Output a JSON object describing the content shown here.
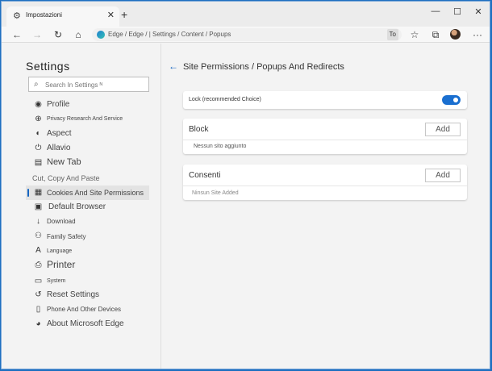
{
  "browser": {
    "tab_title": "Impostazioni",
    "tab_close": "✕",
    "new_tab": "+",
    "window_controls": {
      "minimize": "—",
      "maximize": "☐",
      "close": "✕"
    },
    "address": "Edge / Edge / | Settings / Content / Popups",
    "read_aloud": "To",
    "icons": {
      "back": "←",
      "forward": "→",
      "refresh": "↻",
      "home": "⌂",
      "favorites": "☆",
      "collections": "⧉",
      "more": "···"
    }
  },
  "sidebar": {
    "title": "Settings",
    "search": {
      "placeholder": "Search In Settings ᴺ",
      "icon": "⌕"
    },
    "items": [
      {
        "label": "Profile",
        "icon": "◉"
      },
      {
        "label": "Privacy Research And Service",
        "icon": "⊕"
      },
      {
        "label": "Aspect",
        "icon": "◐"
      },
      {
        "label": "Allavio",
        "icon": "⏻"
      },
      {
        "label": "New Tab",
        "icon": "▤"
      },
      {
        "label": "Cut, Copy And Paste",
        "icon": ""
      },
      {
        "label": "Cookies And Site Permissions",
        "icon": "▦"
      },
      {
        "label": "Default Browser",
        "icon": "▣"
      },
      {
        "label": "Download",
        "icon": "↓"
      },
      {
        "label": "Family Safety",
        "icon": "⚇"
      },
      {
        "label": "Language",
        "icon": "A"
      },
      {
        "label": "Printer",
        "icon": "⎙"
      },
      {
        "label": "System",
        "icon": "▭"
      },
      {
        "label": "Reset Settings",
        "icon": "↺"
      },
      {
        "label": "Phone And Other Devices",
        "icon": "▯"
      },
      {
        "label": "About Microsoft Edge",
        "icon": "◕"
      }
    ]
  },
  "main": {
    "back_icon": "←",
    "title": "Site Permissions / Popups And Redirects",
    "block_toggle": {
      "label": "Lock (recommended Choice)",
      "state": "on",
      "color": "#1a6fd0"
    },
    "block": {
      "title": "Block",
      "add": "Add",
      "empty": "Nessun sito aggiunto"
    },
    "allow": {
      "title": "Consenti",
      "add": "Add",
      "empty": "Ninsun Site Added"
    }
  }
}
